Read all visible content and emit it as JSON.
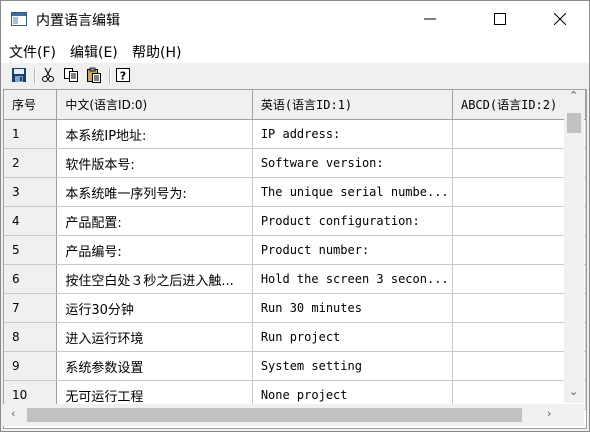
{
  "window": {
    "title": "内置语言编辑"
  },
  "menu": [
    {
      "label": "文件(F)"
    },
    {
      "label": "编辑(E)"
    },
    {
      "label": "帮助(H)"
    }
  ],
  "toolbar": {
    "icons": [
      "save-icon",
      "cut-icon",
      "copy-icon",
      "paste-icon",
      "help-icon"
    ]
  },
  "table": {
    "headers": [
      "序号",
      "中文(语言ID:0)",
      "英语(语言ID:1)",
      "ABCD(语言ID:2)"
    ],
    "rows": [
      {
        "idx": "1",
        "cn": "本系统IP地址:",
        "en": "IP address:",
        "abcd": ""
      },
      {
        "idx": "2",
        "cn": "软件版本号:",
        "en": "Software version:",
        "abcd": ""
      },
      {
        "idx": "3",
        "cn": "本系统唯一序列号为:",
        "en": "The unique serial numbe...",
        "abcd": ""
      },
      {
        "idx": "4",
        "cn": "产品配置:",
        "en": "Product configuration:",
        "abcd": ""
      },
      {
        "idx": "5",
        "cn": "产品编号:",
        "en": "Product number:",
        "abcd": ""
      },
      {
        "idx": "6",
        "cn": "按住空白处３秒之后进入触...",
        "en": "Hold the screen 3 secon...",
        "abcd": ""
      },
      {
        "idx": "7",
        "cn": "运行30分钟",
        "en": "Run 30 minutes",
        "abcd": ""
      },
      {
        "idx": "8",
        "cn": "进入运行环境",
        "en": "Run project",
        "abcd": ""
      },
      {
        "idx": "9",
        "cn": "系统参数设置",
        "en": "System setting",
        "abcd": ""
      },
      {
        "idx": "10",
        "cn": "无可运行工程",
        "en": "None project",
        "abcd": ""
      }
    ]
  }
}
